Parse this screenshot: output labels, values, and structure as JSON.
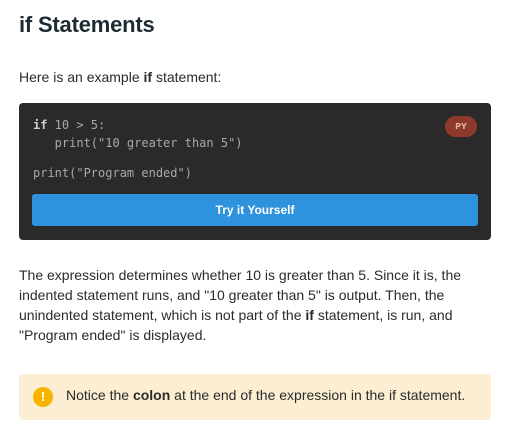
{
  "lesson": {
    "title": "if Statements",
    "intro": {
      "before": "Here is an example ",
      "keyword": "if",
      "after": " statement:"
    },
    "code_block": {
      "language_badge": "PY",
      "lines": [
        {
          "keyword": "if",
          "rest": " 10 > 5:"
        },
        {
          "keyword": "",
          "rest": "   print(\"10 greater than 5\")"
        },
        {
          "keyword": "",
          "rest": "print(\"Program ended\")"
        }
      ],
      "run_button_label": "Try it Yourself"
    },
    "explanation": {
      "part1": "The expression determines whether 10 is greater than 5. Since it is, the indented statement runs, and \"10 greater than 5\" is output. Then, the unindented statement, which is not part of the ",
      "keyword": "if",
      "part2": " statement, is run, and \"Program ended\" is displayed."
    },
    "notice": {
      "icon": "exclamation-icon",
      "icon_glyph": "!",
      "before": "Notice the ",
      "bold": "colon",
      "after": " at the end of the expression in the if statement."
    }
  },
  "colors": {
    "code_background": "#2a2a2a",
    "run_button": "#2e93dc",
    "badge": "#8e3a2a",
    "notice_background": "#fbeed2",
    "notice_icon": "#f6b400"
  }
}
